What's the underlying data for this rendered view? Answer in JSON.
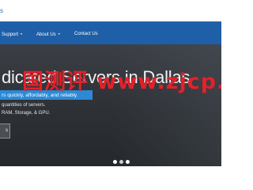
{
  "brand": {
    "fragment": "s"
  },
  "nav": {
    "items": [
      {
        "label": "Support",
        "has_dropdown": true
      },
      {
        "label": "About Us",
        "has_dropdown": true
      },
      {
        "label": "Contact Us",
        "has_dropdown": false
      }
    ],
    "dropdown_caret": "▾"
  },
  "hero": {
    "title": "dicated Servers in Dallas",
    "tagline": "rs quickly, affordably, and reliably.",
    "line_1": "quantities of servers.",
    "line_2": "RAM, Storage, & GPU.",
    "button_label": "s"
  },
  "carousel": {
    "slide_count": 3,
    "active_index": 1
  },
  "watermark": {
    "text": "国测评 www.zjcp.o"
  },
  "colors": {
    "nav_bg": "#1e5fa8",
    "tagline_bg": "#2b89d6",
    "hero_bg": "#2d3136",
    "watermark": "#e3212a"
  }
}
